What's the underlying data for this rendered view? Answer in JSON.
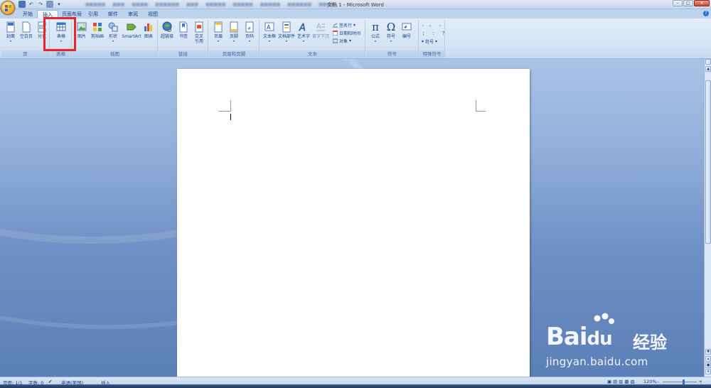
{
  "window": {
    "title": "文档 1 - Microsoft Word"
  },
  "tabs": [
    {
      "label": "开始",
      "active": false
    },
    {
      "label": "插入",
      "active": true
    },
    {
      "label": "页面布局",
      "active": false
    },
    {
      "label": "引用",
      "active": false
    },
    {
      "label": "邮件",
      "active": false
    },
    {
      "label": "审阅",
      "active": false
    },
    {
      "label": "视图",
      "active": false
    }
  ],
  "ribbon": {
    "groups": {
      "pages": {
        "label": "页",
        "buttons": [
          "封面",
          "空白页",
          "分页"
        ]
      },
      "tables": {
        "label": "表格",
        "buttons": [
          "表格"
        ]
      },
      "illustrations": {
        "label": "插图",
        "buttons": [
          "图片",
          "剪贴画",
          "形状",
          "SmartArt",
          "图表"
        ]
      },
      "links": {
        "label": "链接",
        "buttons": [
          "超链接",
          "书签",
          "交叉",
          "引用"
        ]
      },
      "header_footer": {
        "label": "页眉和页脚",
        "buttons": [
          "页眉",
          "页脚",
          "页码"
        ]
      },
      "text": {
        "label": "文本",
        "buttons": [
          "文本框",
          "文档部件",
          "艺术字",
          "首字下沉"
        ],
        "small": [
          "签名行",
          "日期和时间",
          "对象"
        ]
      },
      "symbols": {
        "label": "符号",
        "buttons": [
          "公式",
          "符号",
          "编号"
        ]
      },
      "special": {
        "label": "特殊符号",
        "items": [
          ",",
          "。",
          "、",
          "；",
          "：",
          "？",
          "符号"
        ]
      }
    }
  },
  "status": {
    "page": "页面: 1/1",
    "words": "字数: 0",
    "language": "英语(美国)",
    "mode": "插入",
    "zoom": "120%"
  },
  "watermark": {
    "brand": "Bai",
    "brand2": "du",
    "cn": "经验",
    "url": "jingyan.baidu.com"
  },
  "colors": {
    "accent": "#15428b",
    "highlight": "#e8262a",
    "ribbon_bg": "#d4e2f3"
  }
}
